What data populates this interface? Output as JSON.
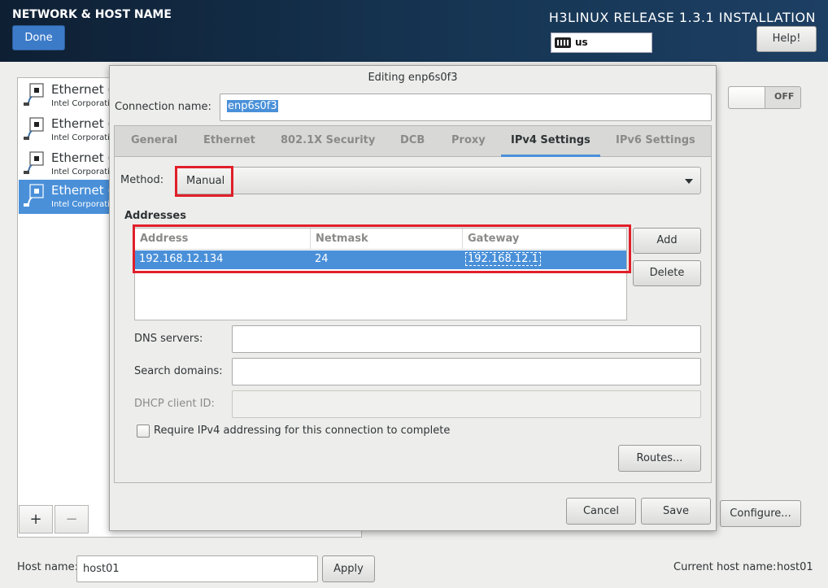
{
  "header": {
    "title": "NETWORK & HOST NAME",
    "done_label": "Done",
    "release": "H3LINUX RELEASE 1.3.1 INSTALLATION",
    "keyboard_layout": "us",
    "help_label": "Help!"
  },
  "devices": [
    {
      "name": "Ethernet (",
      "vendor": "Intel Corporatio"
    },
    {
      "name": "Ethernet (",
      "vendor": "Intel Corporatio"
    },
    {
      "name": "Ethernet (",
      "vendor": "Intel Corporatio"
    },
    {
      "name": "Ethernet (",
      "vendor": "Intel Corporatio"
    }
  ],
  "list_tools": {
    "add": "+",
    "remove": "−"
  },
  "toggle": {
    "state": "OFF"
  },
  "configure_label": "Configure...",
  "hostname": {
    "label": "Host name:",
    "value": "host01",
    "apply_label": "Apply",
    "current_label": "Current host name:",
    "current_value": "host01"
  },
  "dialog": {
    "title": "Editing enp6s0f3",
    "connection_name_label": "Connection name:",
    "connection_name": "enp6s0f3",
    "tabs": [
      "General",
      "Ethernet",
      "802.1X Security",
      "DCB",
      "Proxy",
      "IPv4 Settings",
      "IPv6 Settings"
    ],
    "active_tab": "IPv4 Settings",
    "method_label": "Method:",
    "method_value": "Manual",
    "addresses_heading": "Addresses",
    "columns": [
      "Address",
      "Netmask",
      "Gateway"
    ],
    "rows": [
      {
        "address": "192.168.12.134",
        "netmask": "24",
        "gateway": "192.168.12.1"
      }
    ],
    "add_label": "Add",
    "delete_label": "Delete",
    "dns_label": "DNS servers:",
    "dns_value": "",
    "search_label": "Search domains:",
    "search_value": "",
    "dhcp_label": "DHCP client ID:",
    "dhcp_value": "",
    "require_label": "Require IPv4 addressing for this connection to complete",
    "require_checked": false,
    "routes_label": "Routes...",
    "cancel_label": "Cancel",
    "save_label": "Save"
  }
}
